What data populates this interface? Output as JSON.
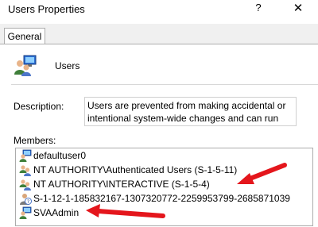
{
  "window": {
    "title": "Users Properties",
    "help_glyph": "?",
    "close_glyph": "✕"
  },
  "tabs": [
    {
      "label": "General",
      "selected": true
    }
  ],
  "group": {
    "name": "Users",
    "icon": "user-group-icon"
  },
  "description": {
    "label": "Description:",
    "value": "Users are prevented from making accidental or intentional system-wide changes and can run most"
  },
  "members": {
    "label": "Members:",
    "items": [
      {
        "name": "defaultuser0",
        "icon": "user-icon"
      },
      {
        "name": "NT AUTHORITY\\Authenticated Users (S-1-5-11)",
        "icon": "user-group-icon"
      },
      {
        "name": "NT AUTHORITY\\INTERACTIVE (S-1-5-4)",
        "icon": "user-group-icon"
      },
      {
        "name": "S-1-12-1-185832167-1307320772-2259953799-2685871039",
        "icon": "unknown-account-icon"
      },
      {
        "name": "SVAAdmin",
        "icon": "user-icon"
      }
    ]
  },
  "colors": {
    "annotation_arrow": "#e4161c",
    "tab_strip": "#f0f0f0"
  }
}
